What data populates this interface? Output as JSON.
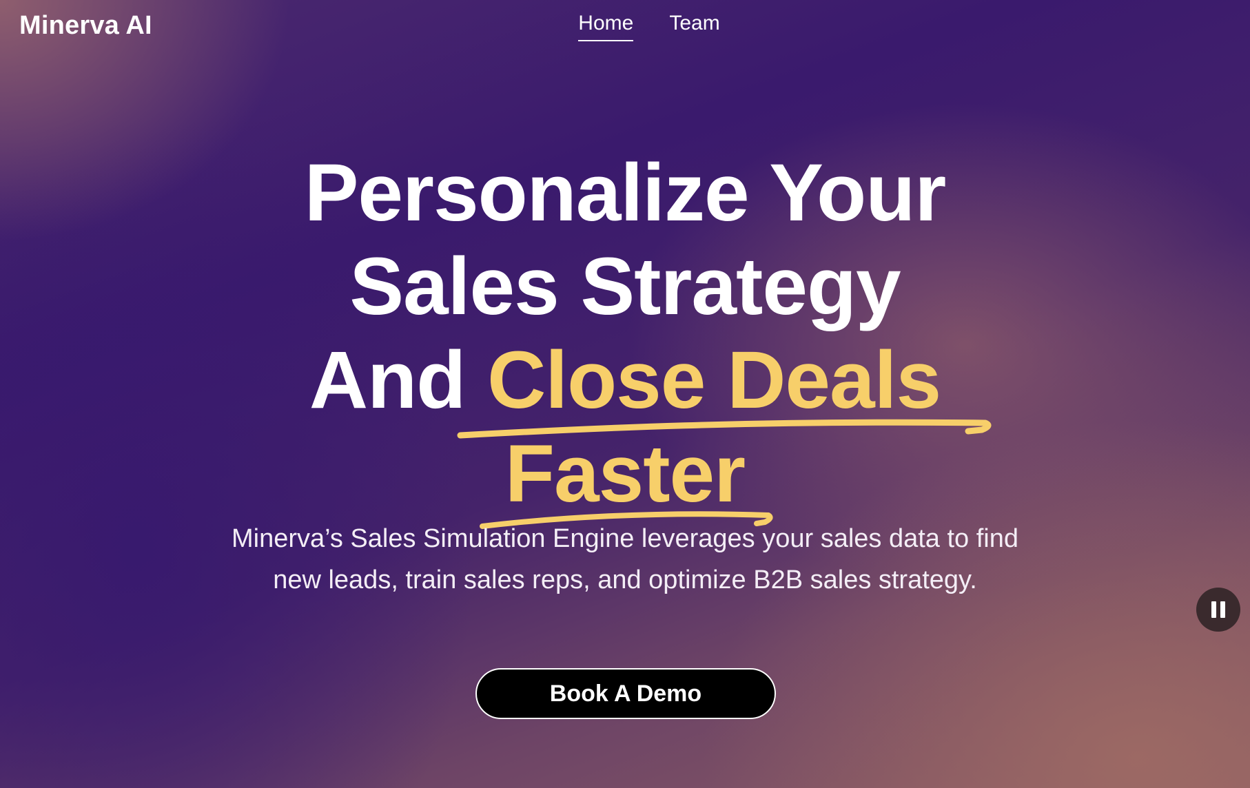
{
  "brand": {
    "name": "Minerva AI"
  },
  "nav": {
    "items": [
      {
        "label": "Home",
        "active": true
      },
      {
        "label": "Team",
        "active": false
      }
    ]
  },
  "hero": {
    "title_line1": "Personalize Your",
    "title_line2": "Sales Strategy",
    "title_line3_prefix": "And",
    "title_highlight_1": "Close Deals",
    "title_highlight_2": "Faster",
    "subtitle": "Minerva’s Sales Simulation Engine leverages your sales data to find new leads, train sales reps, and optimize B2B sales strategy.",
    "cta_label": "Book A Demo"
  },
  "media_controls": {
    "pause_icon": "pause-icon"
  },
  "colors": {
    "highlight": "#f7cf6a",
    "cta_background": "#000000",
    "text": "#ffffff"
  }
}
